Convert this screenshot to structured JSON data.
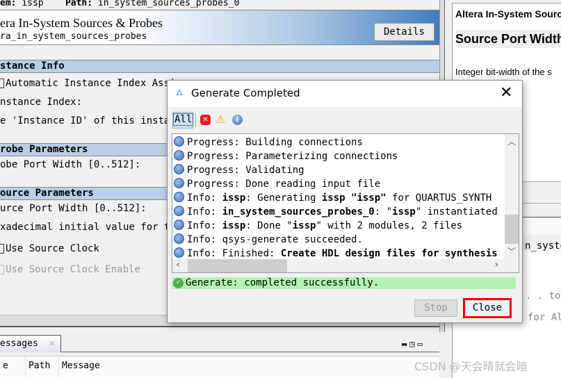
{
  "topbar": {
    "system_label": "em:",
    "system_value": "issp",
    "path_label": "Path:",
    "path_value": "in_system_sources_probes_0"
  },
  "header": {
    "title": "era In-System Sources & Probes",
    "subtitle": "ra_in_system_sources_probes",
    "details_button": "Details"
  },
  "params": {
    "instance_info": "stance Info",
    "auto_index": "Automatic Instance Index Assi",
    "instance_index": "nstance Index:",
    "instance_id": "e 'Instance ID' of this instan",
    "probe_params": "robe Parameters",
    "probe_width": "obe Port Width [0..512]:",
    "source_params": "ource Parameters",
    "source_width": "urce Port Width [0..512]:",
    "hex_initial": "xadecimal initial value for th",
    "use_source_clock": "Use Source Clock",
    "use_source_clock_enable": "Use Source Clock Enable"
  },
  "messages_panel": {
    "tab": "essages",
    "columns": [
      "e",
      "Path",
      "Message"
    ]
  },
  "help": {
    "title": "Altera In-System Sourc",
    "heading": "Source Port Width",
    "text": "Integer bit-width of the s",
    "line1": "n_syste",
    "line2": ". . to",
    "line3": "for Al"
  },
  "dialog": {
    "title": "Generate Completed",
    "filter_all": "All",
    "log": [
      {
        "prefix": "Progress: ",
        "bold1": "",
        "mid": "Building connections",
        "bold2": "",
        "end": ""
      },
      {
        "prefix": "Progress: ",
        "bold1": "",
        "mid": "Parameterizing connections",
        "bold2": "",
        "end": ""
      },
      {
        "prefix": "Progress: ",
        "bold1": "",
        "mid": "Validating",
        "bold2": "",
        "end": ""
      },
      {
        "prefix": "Progress: ",
        "bold1": "",
        "mid": "Done reading input file",
        "bold2": "",
        "end": ""
      },
      {
        "prefix": "Info: ",
        "bold1": "issp",
        "mid": ": Generating ",
        "bold2": "issp \"issp\"",
        "end": " for QUARTUS_SYNTH"
      },
      {
        "prefix": "Info: ",
        "bold1": "in_system_sources_probes_0",
        "mid": ": \"",
        "bold2": "issp",
        "end": "\" instantiated"
      },
      {
        "prefix": "Info: ",
        "bold1": "issp",
        "mid": ": Done \"",
        "bold2": "issp",
        "end": "\" with 2 modules, 2 files"
      },
      {
        "prefix": "Info: ",
        "bold1": "",
        "mid": "qsys-generate succeeded.",
        "bold2": "",
        "end": ""
      },
      {
        "prefix": "Info: ",
        "bold1": "",
        "mid": "Finished: ",
        "bold2": "Create HDL design files for synthesis",
        "end": ""
      }
    ],
    "status": "Generate: completed successfully.",
    "stop_button": "Stop",
    "close_button": "Close"
  },
  "watermark": "CSDN @天会晴就会暗"
}
